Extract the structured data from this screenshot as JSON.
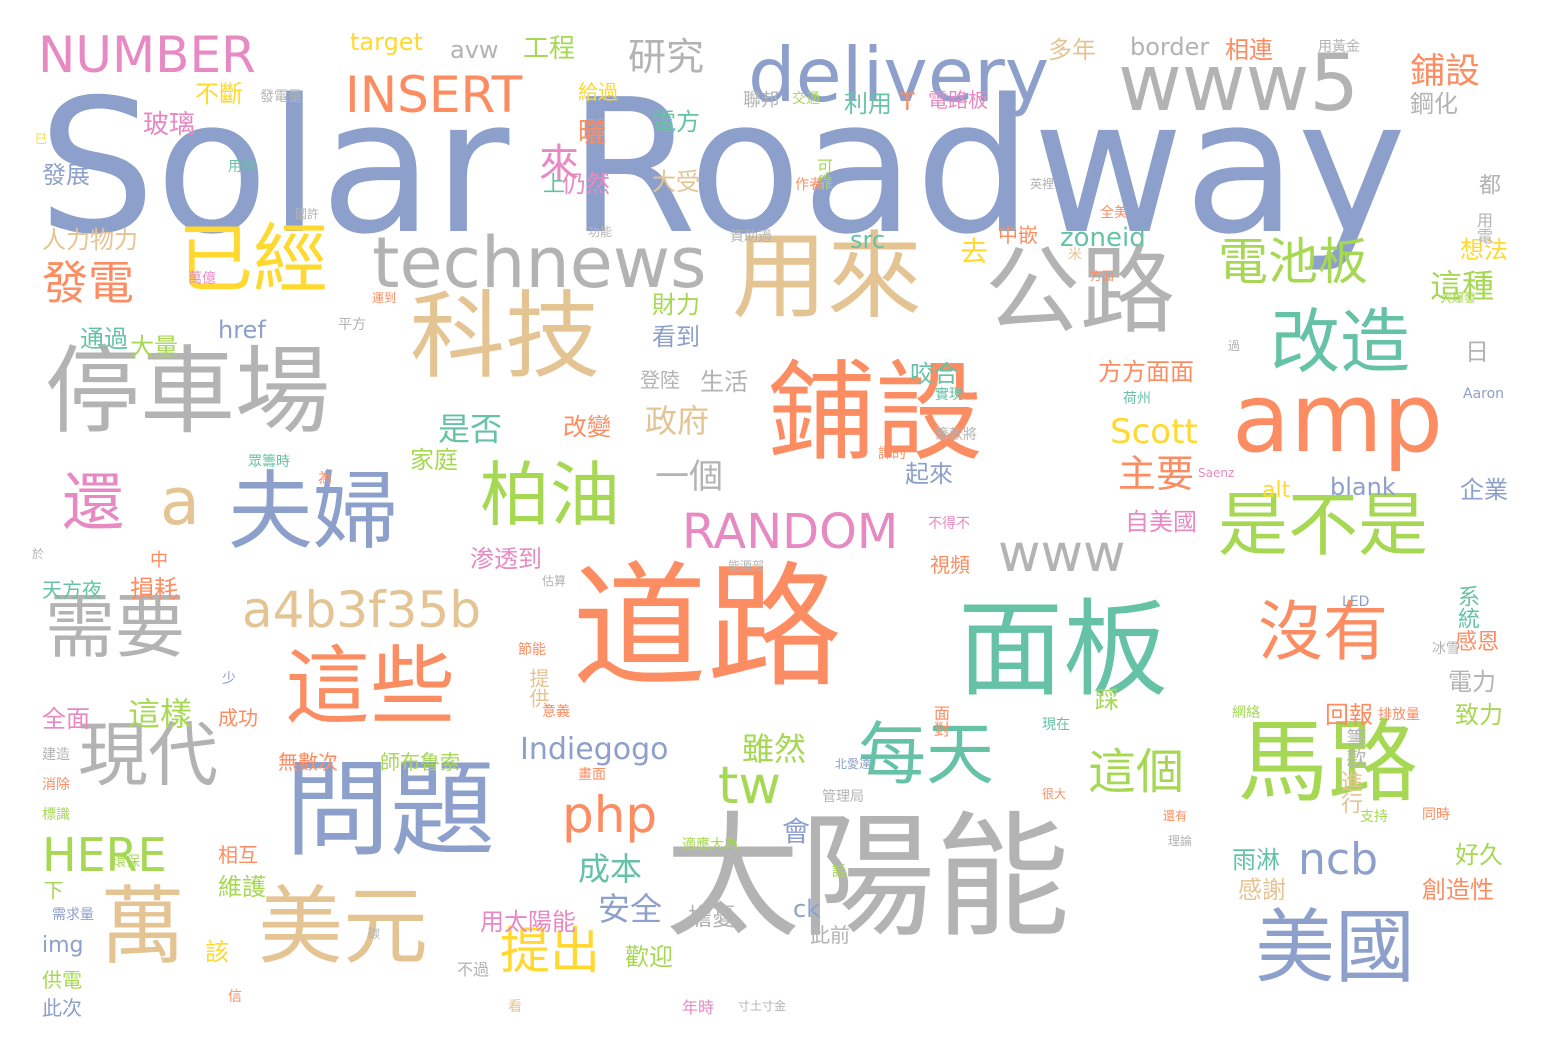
{
  "colors": {
    "blue": "#8da0cb",
    "orange": "#fc8d62",
    "green": "#66c2a5",
    "pink": "#e78ac3",
    "lime": "#a6d854",
    "yellow": "#ffd92f",
    "tan": "#e5c494",
    "gray": "#b3b3b3"
  },
  "words": [
    {
      "text": "Solar Roadway",
      "color": "blue"
    },
    {
      "text": "道路",
      "color": "orange"
    },
    {
      "text": "太陽能",
      "color": "gray"
    },
    {
      "text": "面板",
      "color": "green"
    },
    {
      "text": "鋪設",
      "color": "orange"
    },
    {
      "text": "科技",
      "color": "tan"
    },
    {
      "text": "用來",
      "color": "tan"
    },
    {
      "text": "停車場",
      "color": "gray"
    },
    {
      "text": "問題",
      "color": "blue"
    },
    {
      "text": "公路",
      "color": "gray"
    },
    {
      "text": "amp",
      "color": "orange"
    },
    {
      "text": "這些",
      "color": "orange"
    },
    {
      "text": "夫婦",
      "color": "blue"
    },
    {
      "text": "馬路",
      "color": "lime"
    },
    {
      "text": "美國",
      "color": "blue"
    },
    {
      "text": "萬",
      "color": "tan"
    },
    {
      "text": "美元",
      "color": "tan"
    },
    {
      "text": "www5",
      "color": "gray"
    },
    {
      "text": "delivery",
      "color": "blue"
    },
    {
      "text": "technews",
      "color": "gray"
    },
    {
      "text": "已經",
      "color": "yellow"
    },
    {
      "text": "柏油",
      "color": "lime"
    },
    {
      "text": "是不是",
      "color": "lime"
    },
    {
      "text": "改造",
      "color": "green"
    },
    {
      "text": "現代",
      "color": "gray"
    },
    {
      "text": "需要",
      "color": "gray"
    },
    {
      "text": "每天",
      "color": "green"
    },
    {
      "text": "沒有",
      "color": "orange"
    },
    {
      "text": "a4b3f35b",
      "color": "tan"
    },
    {
      "text": "www",
      "color": "gray"
    },
    {
      "text": "RANDOM",
      "color": "pink"
    },
    {
      "text": "NUMBER",
      "color": "pink"
    },
    {
      "text": "INSERT",
      "color": "orange"
    },
    {
      "text": "php",
      "color": "orange"
    },
    {
      "text": "tw",
      "color": "lime"
    },
    {
      "text": "ncb",
      "color": "blue"
    },
    {
      "text": "還",
      "color": "pink"
    },
    {
      "text": "a",
      "color": "tan"
    },
    {
      "text": "電池板",
      "color": "lime"
    },
    {
      "text": "發電",
      "color": "orange"
    },
    {
      "text": "提出",
      "color": "yellow"
    },
    {
      "text": "HERE",
      "color": "lime"
    },
    {
      "text": "這個",
      "color": "lime"
    },
    {
      "text": "Indiegogo",
      "color": "blue"
    },
    {
      "text": "Scott",
      "color": "yellow"
    },
    {
      "text": "來",
      "color": "pink"
    },
    {
      "text": "研究",
      "color": "gray"
    },
    {
      "text": "鋪設",
      "color": "orange"
    },
    {
      "text": "一個",
      "color": "gray"
    },
    {
      "text": "政府",
      "color": "tan"
    },
    {
      "text": "主要",
      "color": "orange"
    },
    {
      "text": "是否",
      "color": "green"
    },
    {
      "text": "雖然",
      "color": "lime"
    },
    {
      "text": "成本",
      "color": "green"
    },
    {
      "text": "安全",
      "color": "blue"
    },
    {
      "text": "這樣",
      "color": "lime"
    },
    {
      "text": "方方面面",
      "color": "orange"
    },
    {
      "text": "這種",
      "color": "lime"
    },
    {
      "text": "人力物力",
      "color": "tan"
    },
    {
      "text": "target",
      "color": "yellow"
    },
    {
      "text": "avw",
      "color": "gray"
    },
    {
      "text": "工程",
      "color": "lime"
    },
    {
      "text": "border",
      "color": "gray"
    },
    {
      "text": "多年",
      "color": "tan"
    },
    {
      "text": "相連",
      "color": "orange"
    },
    {
      "text": "用黃金",
      "color": "gray"
    },
    {
      "text": "不斷",
      "color": "yellow"
    },
    {
      "text": "發電量",
      "color": "gray"
    },
    {
      "text": "給過",
      "color": "yellow"
    },
    {
      "text": "玻璃",
      "color": "pink"
    },
    {
      "text": "曬",
      "color": "orange"
    },
    {
      "text": "電方",
      "color": "green"
    },
    {
      "text": "聯邦",
      "color": "gray"
    },
    {
      "text": "交通",
      "color": "lime"
    },
    {
      "text": "利用",
      "color": "green"
    },
    {
      "text": "T",
      "color": "orange"
    },
    {
      "text": "電路板",
      "color": "pink"
    },
    {
      "text": "鋼化",
      "color": "gray"
    },
    {
      "text": "發展",
      "color": "blue"
    },
    {
      "text": "仍然",
      "color": "pink"
    },
    {
      "text": "大受",
      "color": "tan"
    },
    {
      "text": "上",
      "color": "green"
    },
    {
      "text": "src",
      "color": "green"
    },
    {
      "text": "中嵌",
      "color": "orange"
    },
    {
      "text": "zoneid",
      "color": "green"
    },
    {
      "text": "資助過",
      "color": "gray"
    },
    {
      "text": "去",
      "color": "yellow"
    },
    {
      "text": "想法",
      "color": "yellow"
    },
    {
      "text": "財力",
      "color": "lime"
    },
    {
      "text": "看到",
      "color": "blue"
    },
    {
      "text": "href",
      "color": "blue"
    },
    {
      "text": "大量",
      "color": "lime"
    },
    {
      "text": "通過",
      "color": "green"
    },
    {
      "text": "日",
      "color": "gray"
    },
    {
      "text": "登陸",
      "color": "gray"
    },
    {
      "text": "生活",
      "color": "gray"
    },
    {
      "text": "咬合",
      "color": "green"
    },
    {
      "text": "改變",
      "color": "orange"
    },
    {
      "text": "家庭",
      "color": "lime"
    },
    {
      "text": "起來",
      "color": "blue"
    },
    {
      "text": "blank",
      "color": "blue"
    },
    {
      "text": "alt",
      "color": "yellow"
    },
    {
      "text": "企業",
      "color": "blue"
    },
    {
      "text": "自美國",
      "color": "pink"
    },
    {
      "text": "渗透到",
      "color": "pink"
    },
    {
      "text": "損耗",
      "color": "orange"
    },
    {
      "text": "天方夜",
      "color": "green"
    },
    {
      "text": "系統",
      "color": "green"
    },
    {
      "text": "視頻",
      "color": "orange"
    },
    {
      "text": "感恩",
      "color": "orange"
    },
    {
      "text": "電力",
      "color": "gray"
    },
    {
      "text": "提供",
      "color": "tan"
    },
    {
      "text": "踩",
      "color": "lime"
    },
    {
      "text": "回報",
      "color": "orange"
    },
    {
      "text": "致力",
      "color": "lime"
    },
    {
      "text": "成功",
      "color": "orange"
    },
    {
      "text": "全面",
      "color": "pink"
    },
    {
      "text": "無數次",
      "color": "orange"
    },
    {
      "text": "師布魯索",
      "color": "lime"
    },
    {
      "text": "籌款",
      "color": "gray"
    },
    {
      "text": "進行",
      "color": "tan"
    },
    {
      "text": "相互",
      "color": "orange"
    },
    {
      "text": "維護",
      "color": "lime"
    },
    {
      "text": "會",
      "color": "blue"
    },
    {
      "text": "雨淋",
      "color": "green"
    },
    {
      "text": "好久",
      "color": "lime"
    },
    {
      "text": "感謝",
      "color": "tan"
    },
    {
      "text": "創造性",
      "color": "orange"
    },
    {
      "text": "下",
      "color": "lime"
    },
    {
      "text": "ck",
      "color": "blue"
    },
    {
      "text": "此前",
      "color": "gray"
    },
    {
      "text": "用太陽能",
      "color": "pink"
    },
    {
      "text": "img",
      "color": "blue"
    },
    {
      "text": "該",
      "color": "yellow"
    },
    {
      "text": "歡迎",
      "color": "lime"
    },
    {
      "text": "供電",
      "color": "lime"
    },
    {
      "text": "此次",
      "color": "blue"
    },
    {
      "text": "不過",
      "color": "gray"
    },
    {
      "text": "年時",
      "color": "pink"
    },
    {
      "text": "都",
      "color": "gray"
    },
    {
      "text": "用電",
      "color": "gray"
    },
    {
      "text": "中",
      "color": "orange"
    },
    {
      "text": "能源部",
      "color": "gray"
    },
    {
      "text": "估算",
      "color": "gray"
    },
    {
      "text": "LED",
      "color": "blue"
    },
    {
      "text": "冰雪",
      "color": "gray"
    },
    {
      "text": "網絡",
      "color": "lime"
    },
    {
      "text": "排放量",
      "color": "orange"
    },
    {
      "text": "現在",
      "color": "green"
    },
    {
      "text": "管理局",
      "color": "gray"
    },
    {
      "text": "北愛達",
      "color": "blue"
    },
    {
      "text": "還有",
      "color": "orange"
    },
    {
      "text": "支持",
      "color": "lime"
    },
    {
      "text": "同時",
      "color": "orange"
    },
    {
      "text": "很大",
      "color": "orange"
    },
    {
      "text": "理論",
      "color": "gray"
    },
    {
      "text": "可靠",
      "color": "lime"
    },
    {
      "text": "作者",
      "color": "orange"
    },
    {
      "text": "英裡",
      "color": "gray"
    },
    {
      "text": "全美",
      "color": "orange"
    },
    {
      "text": "功能",
      "color": "gray"
    },
    {
      "text": "Aaron",
      "color": "blue"
    },
    {
      "text": "Saenz",
      "color": "pink"
    },
    {
      "text": "荷州",
      "color": "green"
    },
    {
      "text": "籌款將",
      "color": "gray"
    },
    {
      "text": "實現",
      "color": "green"
    },
    {
      "text": "譚的",
      "color": "orange"
    },
    {
      "text": "不得不",
      "color": "pink"
    },
    {
      "text": "眾籌時",
      "color": "green"
    },
    {
      "text": "運到",
      "color": "orange"
    },
    {
      "text": "平方",
      "color": "gray"
    },
    {
      "text": "方面",
      "color": "orange"
    },
    {
      "text": "米",
      "color": "tan"
    },
    {
      "text": "過",
      "color": "gray"
    },
    {
      "text": "大爆發",
      "color": "lime"
    },
    {
      "text": "萬億",
      "color": "pink"
    },
    {
      "text": "用作",
      "color": "green"
    },
    {
      "text": "國許",
      "color": "gray"
    },
    {
      "text": "為",
      "color": "orange"
    },
    {
      "text": "少",
      "color": "blue"
    },
    {
      "text": "建造",
      "color": "gray"
    },
    {
      "text": "消除",
      "color": "orange"
    },
    {
      "text": "標識",
      "color": "lime"
    },
    {
      "text": "環保",
      "color": "lime"
    },
    {
      "text": "需求量",
      "color": "blue"
    },
    {
      "text": "看",
      "color": "tan"
    },
    {
      "text": "信",
      "color": "orange"
    },
    {
      "text": "碳",
      "color": "gray"
    },
    {
      "text": "寸土寸金",
      "color": "gray"
    },
    {
      "text": "適應大為",
      "color": "lime"
    },
    {
      "text": "話",
      "color": "lime"
    },
    {
      "text": "畫面",
      "color": "orange"
    },
    {
      "text": "意義",
      "color": "orange"
    },
    {
      "text": "節能",
      "color": "orange"
    },
    {
      "text": "面對",
      "color": "orange"
    },
    {
      "text": "於",
      "color": "gray"
    },
    {
      "text": "巳",
      "color": "yellow"
    },
    {
      "text": "擔憂",
      "color": "gray"
    },
    {
      "text": "他",
      "color": "lime"
    }
  ]
}
